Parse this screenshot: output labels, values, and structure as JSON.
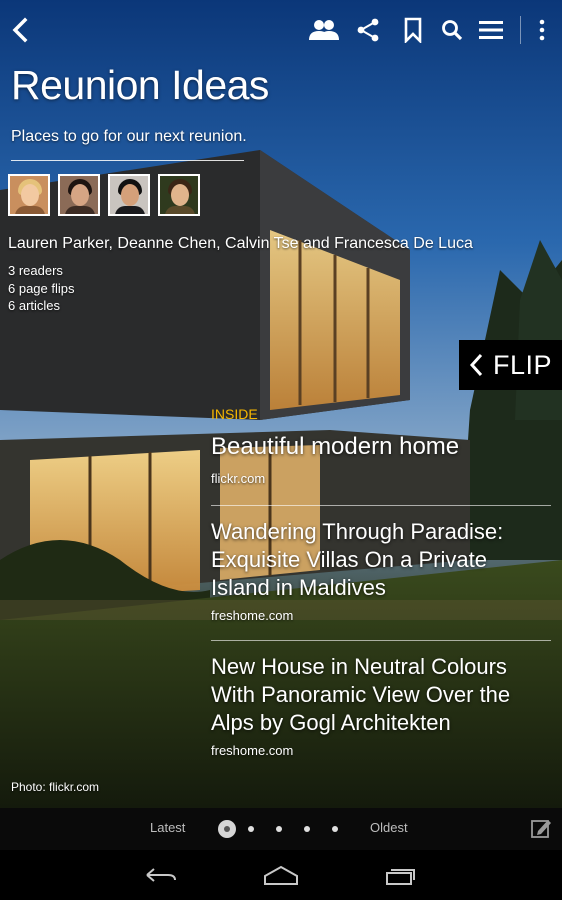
{
  "app": {
    "toolbar": {
      "back_icon": "chevron-left-icon",
      "icons": [
        "contributors-icon",
        "share-icon",
        "bookmark-icon",
        "search-icon",
        "menu-icon",
        "overflow-icon"
      ]
    }
  },
  "magazine": {
    "title": "Reunion Ideas",
    "subtitle": "Places to go for our next reunion.",
    "contributors": "Lauren Parker, Deanne Chen, Calvin Tse and Francesca De Luca",
    "stats": {
      "readers": "3 readers",
      "page_flips": "6 page flips",
      "articles": "6 articles"
    }
  },
  "flip_button": {
    "label": "FLIP"
  },
  "inside": {
    "label": "INSIDE",
    "articles": [
      {
        "title": "Beautiful modern home",
        "source": "flickr.com"
      },
      {
        "title": "Wandering Through Paradise: Exquisite Villas On a Private Island in Maldives",
        "source": "freshome.com"
      },
      {
        "title": "New House in Neutral Colours With Panoramic View Over the Alps by Gogl Architekten",
        "source": "freshome.com"
      }
    ]
  },
  "photo_credit": "Photo: flickr.com",
  "pager": {
    "latest_label": "Latest",
    "oldest_label": "Oldest",
    "page_count": 5,
    "current_page": 1,
    "compose_icon": "compose-icon"
  },
  "system_nav": [
    "back-nav-icon",
    "home-nav-icon",
    "recents-nav-icon"
  ],
  "colors": {
    "accent": "#f5b700",
    "flip_bg": "#000000",
    "pager_bg": "#0a0a0a"
  }
}
